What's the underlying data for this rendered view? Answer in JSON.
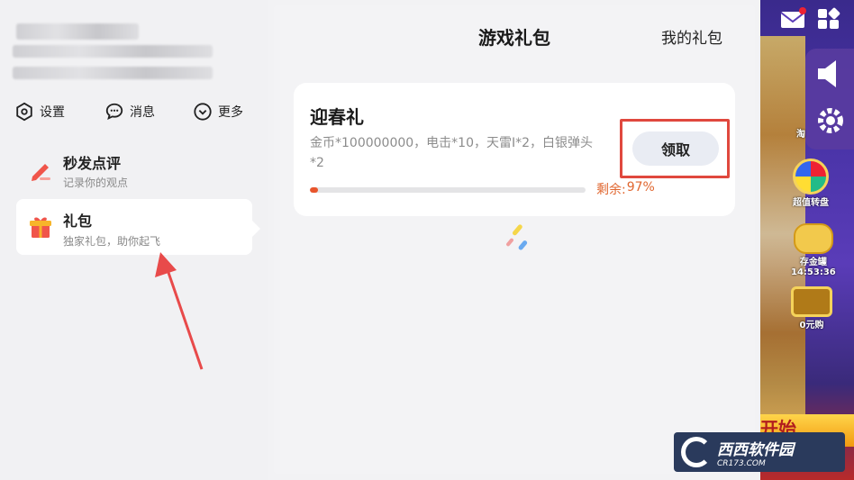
{
  "sidebar": {
    "quick_actions": [
      {
        "label": "设置",
        "icon": "settings-icon"
      },
      {
        "label": "消息",
        "icon": "chat-bubble-icon"
      },
      {
        "label": "更多",
        "icon": "chevron-down-circle-icon"
      }
    ],
    "menu": [
      {
        "title": "秒发点评",
        "subtitle": "记录你的观点",
        "icon": "pencil-icon",
        "active": false
      },
      {
        "title": "礼包",
        "subtitle": "独家礼包，助你起飞",
        "icon": "gift-icon",
        "active": true
      }
    ]
  },
  "main": {
    "title": "游戏礼包",
    "my_gifts_label": "我的礼包",
    "gift": {
      "name": "迎春礼",
      "description": "金币*100000000，电击*10，天雷I*2，白银弹头*2",
      "claim_label": "领取",
      "remaining_label": "剩余:",
      "remaining_value": "97%",
      "progress_fill": 0.03
    }
  },
  "game_strip": {
    "wheel_label": "超值转盘",
    "piggy_label": "存金罐",
    "timer": "14:53:36",
    "chest_label": "0元购",
    "side_text": "淘",
    "banner_text": "开始"
  },
  "watermark": {
    "main": "西西软件园",
    "sub": "CR173.COM"
  },
  "colors": {
    "accent": "#e8552c",
    "highlight": "#e0483e",
    "arrow": "#e84a4a"
  }
}
